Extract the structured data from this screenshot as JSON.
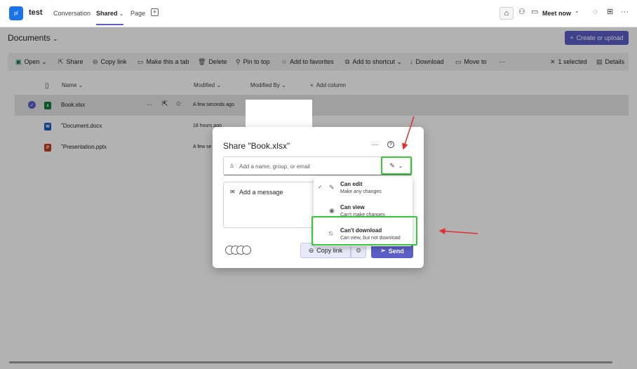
{
  "app": {
    "badge": "pl",
    "title": "test"
  },
  "tabs": [
    {
      "label": "Conversation"
    },
    {
      "label": "Shared"
    },
    {
      "label": "Page"
    }
  ],
  "header": {
    "meet_now": "Meet now"
  },
  "documents": {
    "title": "Documents",
    "create_label": "Create or upload"
  },
  "commands": {
    "open": "Open",
    "share": "Share",
    "copy_link": "Copy link",
    "make_tab": "Make this a tab",
    "delete": "Delete",
    "pin": "Pin to top",
    "favorites": "Add to favorites",
    "shortcut": "Add to shortcut",
    "download": "Download",
    "move": "Move to",
    "more": "···",
    "selected": "1 selected",
    "details": "Details"
  },
  "columns": {
    "name": "Name",
    "modified": "Modified",
    "modified_by": "Modified By",
    "add_column": "Add column"
  },
  "files": [
    {
      "name": "Book.xlsx",
      "modified": "A few seconds ago",
      "type": "x",
      "color": "#107c41"
    },
    {
      "name": "Document.docx",
      "modified": "18 hours ago",
      "type": "W",
      "color": "#185abd"
    },
    {
      "name": "Presentation.pptx",
      "modified": "A few se",
      "type": "P",
      "color": "#c43e1c"
    }
  ],
  "share_dialog": {
    "title": "Share \"Book.xlsx\"",
    "more": "···",
    "help": "?",
    "name_placeholder": "Add a name, group, or email",
    "message_label": "Add a message",
    "copy_link": "Copy link",
    "send": "Send"
  },
  "permissions": [
    {
      "title": "Can edit",
      "desc": "Make any changes"
    },
    {
      "title": "Can view",
      "desc": "Can't make changes"
    },
    {
      "title": "Can't download",
      "desc": "Can view, but not download"
    }
  ],
  "colors": {
    "accent": "#5b5fc7",
    "highlight": "#38c938",
    "arrow": "#e03030"
  }
}
